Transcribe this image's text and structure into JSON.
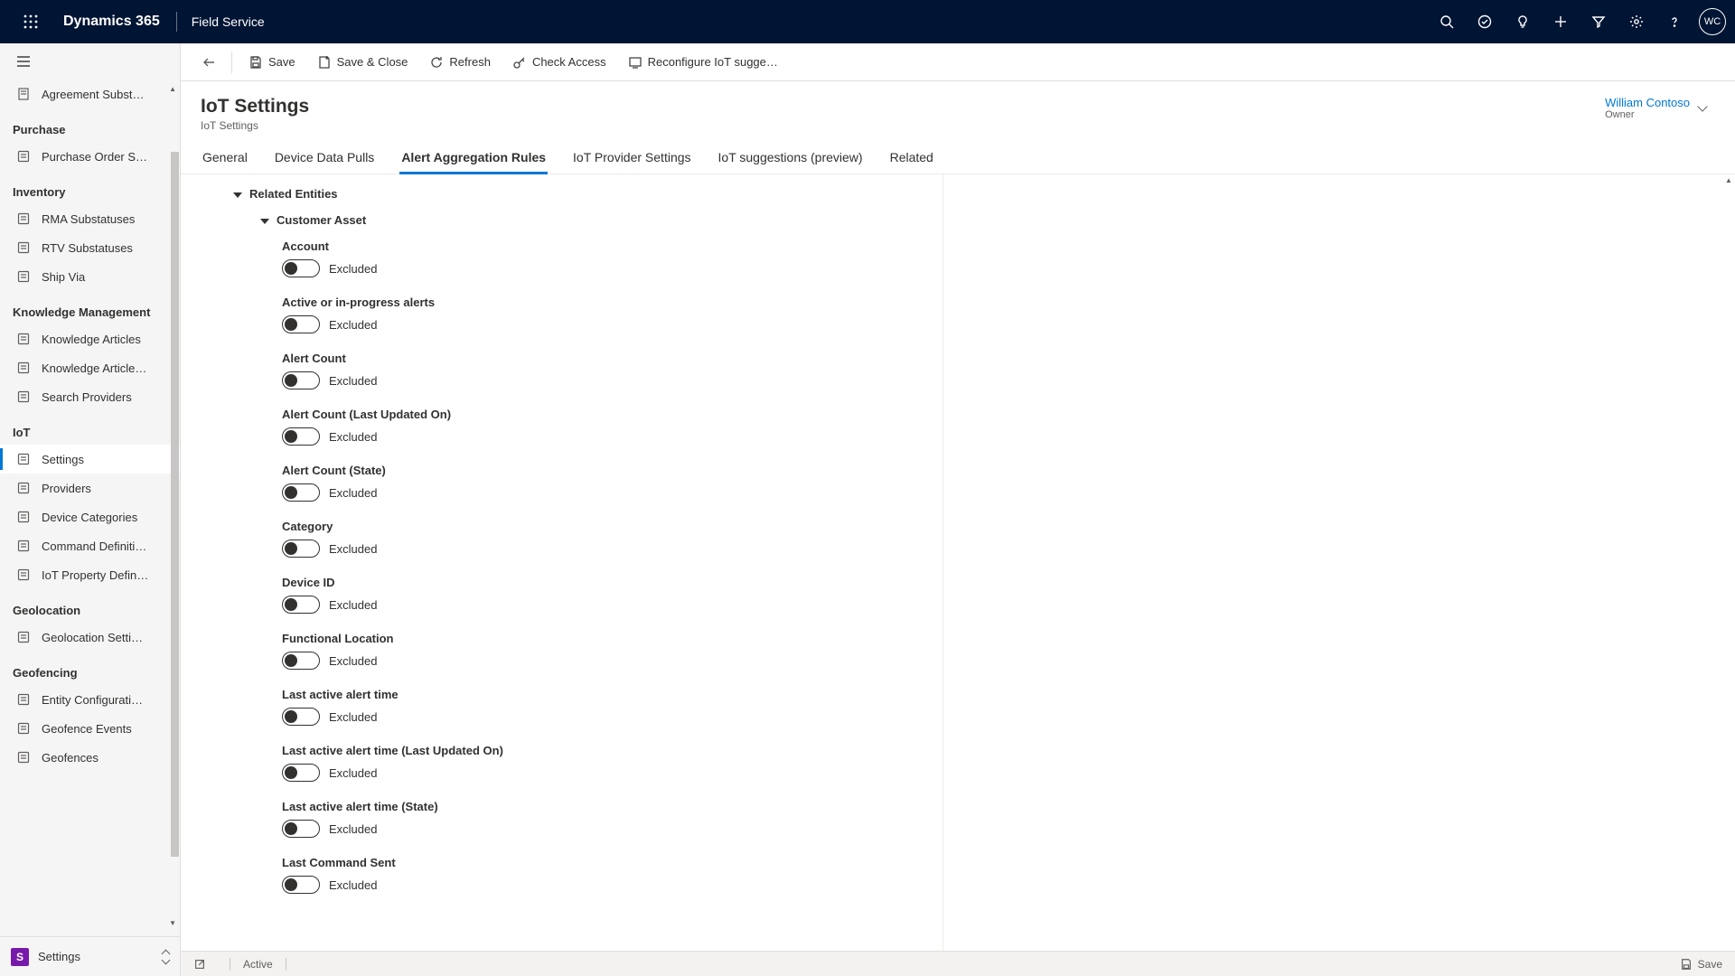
{
  "topbar": {
    "brand": "Dynamics 365",
    "module": "Field Service",
    "avatar_initials": "WC"
  },
  "commands": {
    "save": "Save",
    "save_close": "Save & Close",
    "refresh": "Refresh",
    "check_access": "Check Access",
    "reconfigure": "Reconfigure IoT sugge…"
  },
  "header": {
    "title": "IoT Settings",
    "subtitle": "IoT Settings",
    "owner_name": "William Contoso",
    "owner_role": "Owner"
  },
  "tabs": [
    {
      "label": "General"
    },
    {
      "label": "Device Data Pulls"
    },
    {
      "label": "Alert Aggregation Rules",
      "active": true
    },
    {
      "label": "IoT Provider Settings"
    },
    {
      "label": "IoT suggestions (preview)"
    },
    {
      "label": "Related"
    }
  ],
  "panel": {
    "section": "Related Entities",
    "subsection": "Customer Asset",
    "fields": [
      {
        "label": "Account",
        "state": "Excluded"
      },
      {
        "label": "Active or in-progress alerts",
        "state": "Excluded"
      },
      {
        "label": "Alert Count",
        "state": "Excluded"
      },
      {
        "label": "Alert Count (Last Updated On)",
        "state": "Excluded"
      },
      {
        "label": "Alert Count (State)",
        "state": "Excluded"
      },
      {
        "label": "Category",
        "state": "Excluded"
      },
      {
        "label": "Device ID",
        "state": "Excluded"
      },
      {
        "label": "Functional Location",
        "state": "Excluded"
      },
      {
        "label": "Last active alert time",
        "state": "Excluded"
      },
      {
        "label": "Last active alert time (Last Updated On)",
        "state": "Excluded"
      },
      {
        "label": "Last active alert time (State)",
        "state": "Excluded"
      },
      {
        "label": "Last Command Sent",
        "state": "Excluded"
      }
    ]
  },
  "leftnav": {
    "top_item": "Agreement Subst…",
    "groups": [
      {
        "head": "Purchase",
        "items": [
          "Purchase Order S…"
        ]
      },
      {
        "head": "Inventory",
        "items": [
          "RMA Substatuses",
          "RTV Substatuses",
          "Ship Via"
        ]
      },
      {
        "head": "Knowledge Management",
        "items": [
          "Knowledge Articles",
          "Knowledge Article…",
          "Search Providers"
        ]
      },
      {
        "head": "IoT",
        "items": [
          "Settings",
          "Providers",
          "Device Categories",
          "Command Definiti…",
          "IoT Property Defin…"
        ]
      },
      {
        "head": "Geolocation",
        "items": [
          "Geolocation Setti…"
        ]
      },
      {
        "head": "Geofencing",
        "items": [
          "Entity Configurati…",
          "Geofence Events",
          "Geofences"
        ]
      }
    ],
    "active": "Settings",
    "area": "Settings",
    "area_initial": "S"
  },
  "statusbar": {
    "state": "Active",
    "save": "Save"
  }
}
